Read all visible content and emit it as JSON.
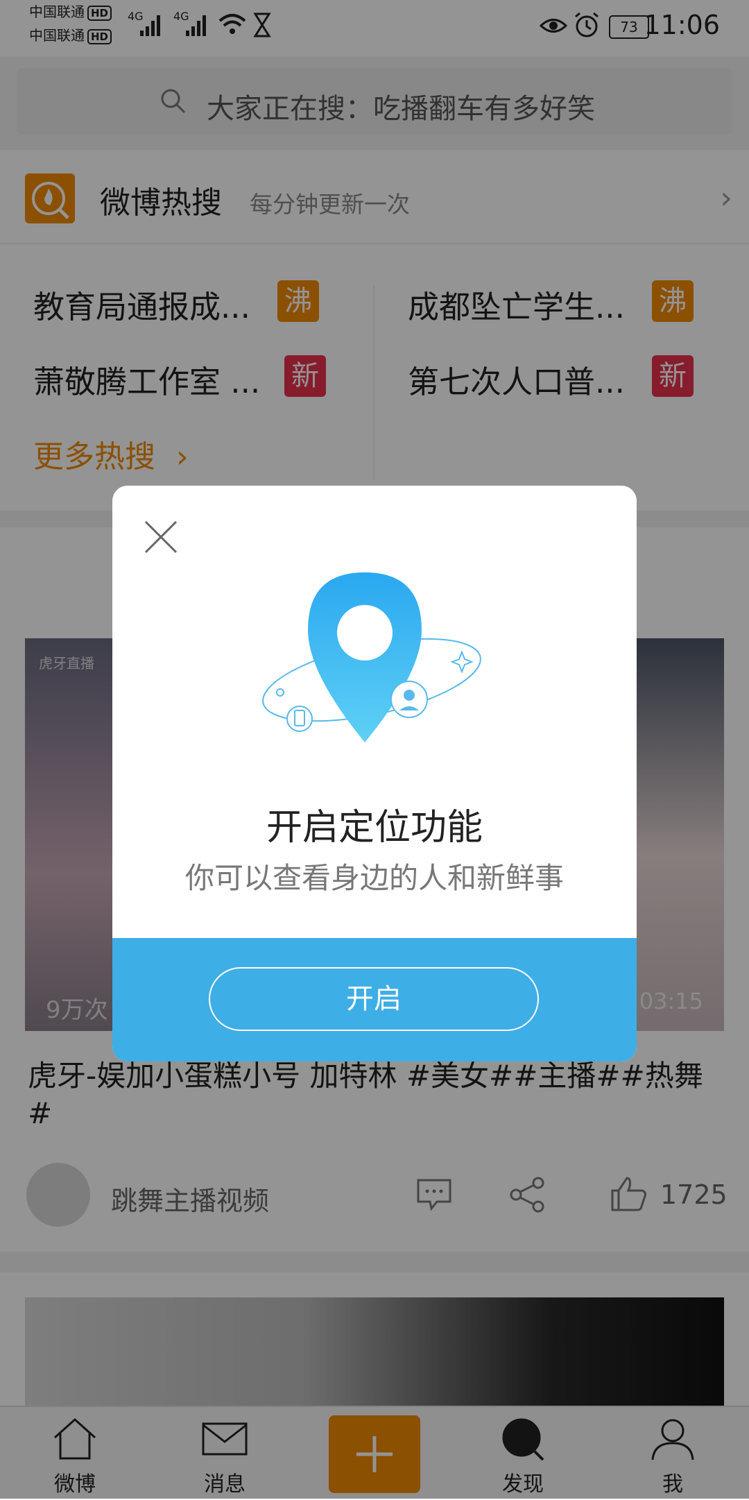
{
  "status_bar": {
    "carrier1": "中国联通",
    "carrier2": "中国联通",
    "hd": "HD",
    "network": "4G",
    "battery": "73",
    "time": "11:06"
  },
  "search": {
    "text": "大家正在搜：吃播翻车有多好笑"
  },
  "hot": {
    "title": "微博热搜",
    "subtitle": "每分钟更新一次",
    "items": [
      {
        "text": "教育局通报成...",
        "tag": "沸"
      },
      {
        "text": "成都坠亡学生...",
        "tag": "沸"
      },
      {
        "text": "萧敬腾工作室 ...",
        "tag": "新"
      },
      {
        "text": "第七次人口普...",
        "tag": "新"
      }
    ],
    "more": "更多热搜"
  },
  "post": {
    "video_logo": "虎牙直播",
    "views": "9万次",
    "duration": "03:15",
    "title": "虎牙-娱加小蛋糕小号 加特林 #美女##主播##热舞#",
    "author": "跳舞主播视频",
    "likes": "1725"
  },
  "tabbar": {
    "items": [
      {
        "label": "微博",
        "icon": "home-icon"
      },
      {
        "label": "消息",
        "icon": "mail-icon"
      },
      {
        "label": "",
        "icon": "plus-icon"
      },
      {
        "label": "发现",
        "icon": "discover-icon"
      },
      {
        "label": "我",
        "icon": "profile-icon"
      }
    ]
  },
  "modal": {
    "title": "开启定位功能",
    "subtitle": "你可以查看身边的人和新鲜事",
    "button": "开启",
    "icon": "location-pin-icon",
    "accent": "#3eaee6"
  }
}
